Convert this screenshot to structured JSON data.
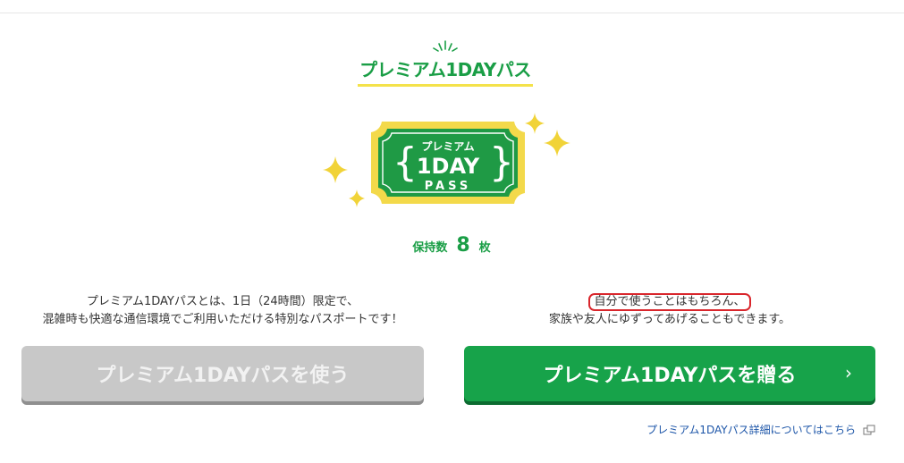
{
  "heading": {
    "title": "プレミアム1DAYパス"
  },
  "ticket": {
    "line1": "プレミアム",
    "line2": "1DAY",
    "line3": "PASS"
  },
  "counter": {
    "label": "保持数",
    "value": "8",
    "unit": "枚"
  },
  "use_section": {
    "desc_line1": "プレミアム1DAYパスとは、1日（24時間）限定で、",
    "desc_line2": "混雑時も快適な通信環境でご利用いただける特別なパスポートです！",
    "button_label": "プレミアム1DAYパスを使う"
  },
  "gift_section": {
    "desc_line1": "自分で使うことはもちろん、",
    "desc_line2": "家族や友人にゆずってあげることもできます。",
    "button_label": "プレミアム1DAYパスを贈る",
    "chevron": "›"
  },
  "detail_link": {
    "label": "プレミアム1DAYパス詳細についてはこちら"
  },
  "colors": {
    "brand_green": "#17a34a",
    "accent_yellow": "#f4e24a",
    "disabled_gray": "#c8c8c8",
    "highlight_red": "#d9262c",
    "link_blue": "#1c55a8"
  },
  "icons": [
    "sparkle-lines-icon",
    "sparkle-icon",
    "chevron-right-icon",
    "external-link-icon"
  ]
}
